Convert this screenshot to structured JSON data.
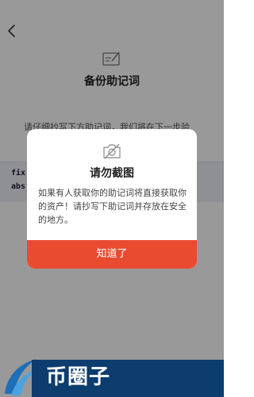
{
  "header": {
    "back_icon": "chevron-left-icon",
    "title_icon": "pencil-note-icon",
    "title": "备份助记词"
  },
  "intro": {
    "text": "请仔细抄写下方助记词，我们将在下一步验"
  },
  "phrase": {
    "line1": "fix v",
    "line2": "abs"
  },
  "step_hint": "一步",
  "modal": {
    "icon": "no-screenshot-icon",
    "title": "请勿截图",
    "body": "如果有人获取你的助记词将直接获取你的资产！请抄写下助记词并存放在安全的地方。",
    "button_label": "知道了",
    "button_color": "#e94b31"
  },
  "watermark": {
    "text": "币圈子"
  }
}
